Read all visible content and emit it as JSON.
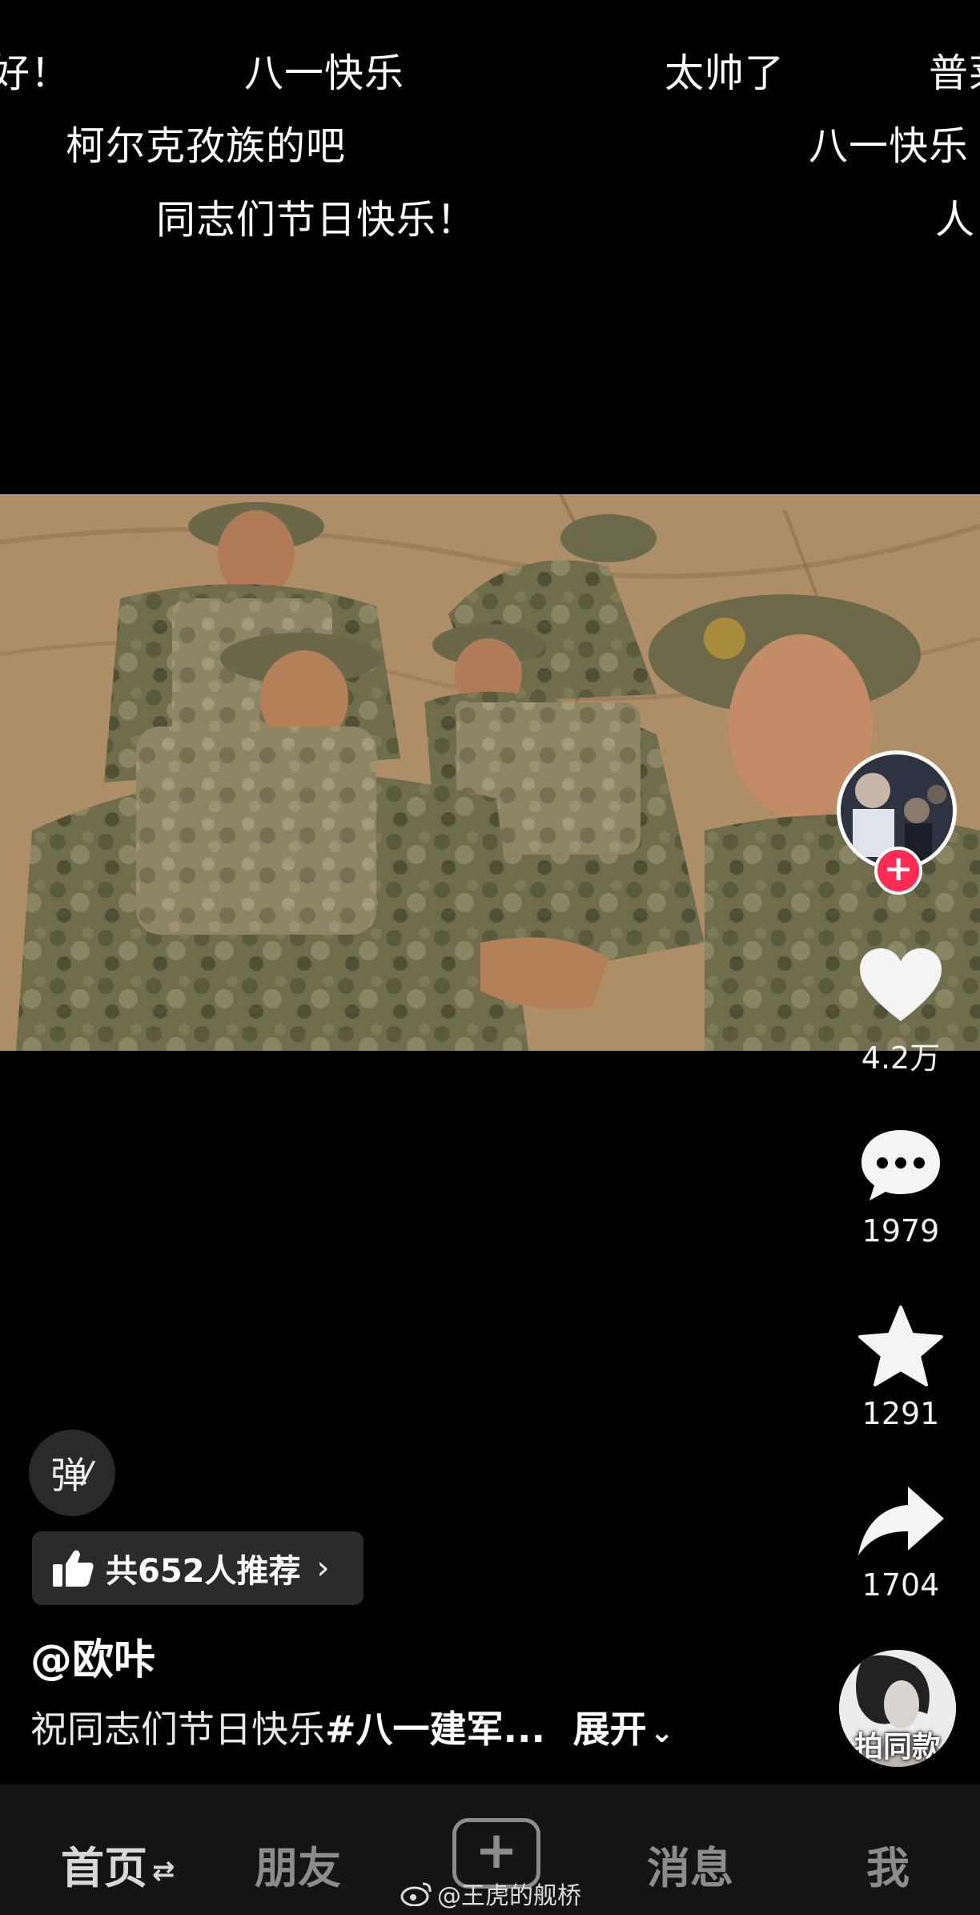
{
  "danmaku": [
    {
      "text": "好！"
    },
    {
      "text": "八一快乐"
    },
    {
      "text": "太帅了"
    },
    {
      "text": "普莱"
    },
    {
      "text": "柯尔克孜族的吧"
    },
    {
      "text": "八一快乐"
    },
    {
      "text": "同志们节日快乐！"
    },
    {
      "text": "人"
    }
  ],
  "actions": {
    "follow_icon": "plus-icon",
    "like_count": "4.2万",
    "comment_count": "1979",
    "favorite_count": "1291",
    "share_count": "1704",
    "remix_label": "拍同款"
  },
  "danmaku_toggle_label": "弹",
  "recommend": {
    "label": "共652人推荐",
    "icon": "thumbs-up-icon"
  },
  "author": {
    "name": "@欧咔"
  },
  "caption": {
    "text": "祝同志们节日快乐",
    "hashtag": "#八一建军...",
    "expand_label": "展开"
  },
  "nav": {
    "items": [
      {
        "label": "首页"
      },
      {
        "label": "朋友"
      },
      {
        "label": "消息"
      },
      {
        "label": "我"
      }
    ]
  },
  "watermark": "@王虎的舰桥",
  "colors": {
    "accent": "#fe2c55",
    "nav_bg": "#141414",
    "chip_bg": "#2b2b2b"
  }
}
